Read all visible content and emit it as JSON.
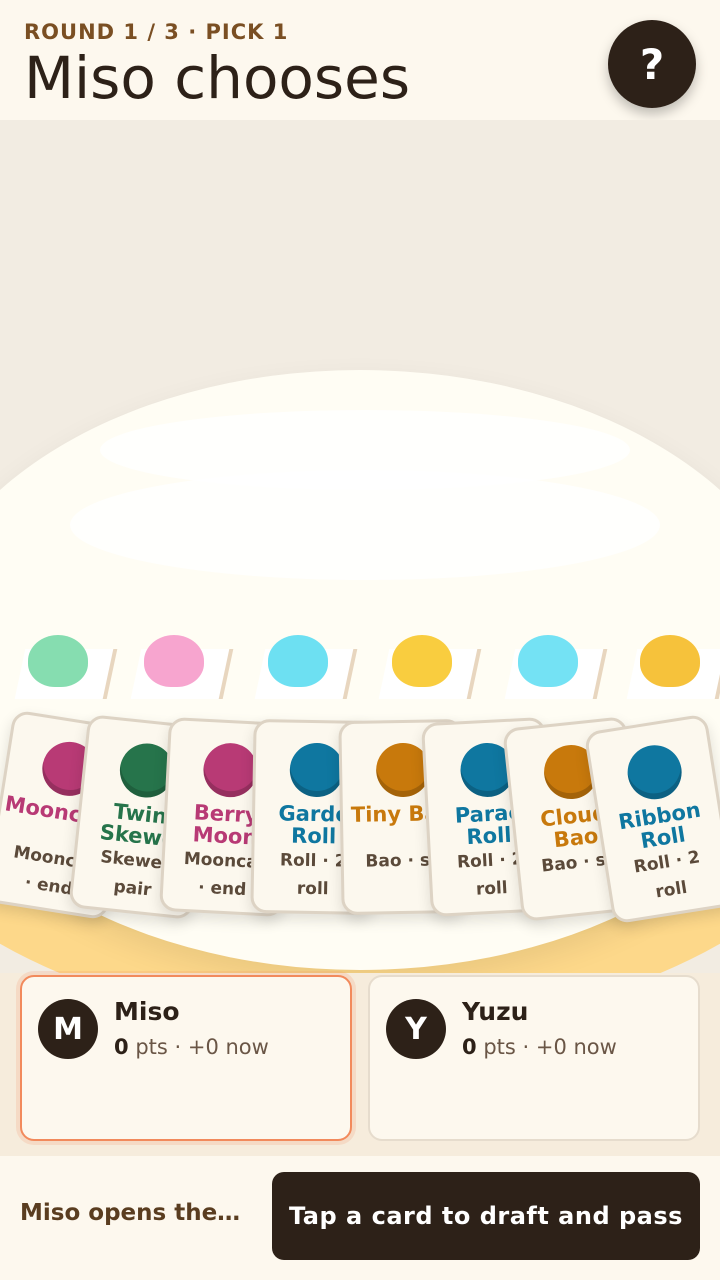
{
  "header": {
    "round_label": "ROUND 1 / 3 · PICK 1",
    "title": "Miso chooses",
    "help_label": "?"
  },
  "table": {
    "dumplings": [
      {
        "color": "#86ddb0"
      },
      {
        "color": "#f7a5cf"
      },
      {
        "color": "#6de0f2"
      },
      {
        "color": "#f9cd3f"
      },
      {
        "color": "#74e2f4"
      },
      {
        "color": "#f6c23b"
      }
    ],
    "hand": [
      {
        "name": "Moonc ke",
        "type": "Mooncal",
        "desc": "· end",
        "color": "#b83a75",
        "name_color": "#b83a75"
      },
      {
        "name": "Twin Skewe",
        "type": "Skewer",
        "desc": "pair",
        "color": "#26744b",
        "name_color": "#26744b"
      },
      {
        "name": "Berry Moon",
        "type": "Mooncal",
        "desc": "· end",
        "color": "#b83a75",
        "name_color": "#b83a75"
      },
      {
        "name": "Garde Roll",
        "type": "Roll · 2",
        "desc": "roll",
        "color": "#0f77a0",
        "name_color": "#0f77a0"
      },
      {
        "name": "Tiny Bao",
        "type": "Bao · sc",
        "desc": "",
        "color": "#c8790c",
        "name_color": "#c8790c"
      },
      {
        "name": "Parac Roll",
        "type": "Roll · 2",
        "desc": "roll",
        "color": "#0f77a0",
        "name_color": "#0f77a0"
      },
      {
        "name": "Cloud Bao",
        "type": "Bao · sc",
        "desc": "",
        "color": "#c8790c",
        "name_color": "#c8790c"
      },
      {
        "name": "Ribbon Roll",
        "type": "Roll · 2",
        "desc": "roll",
        "color": "#0f77a0",
        "name_color": "#0f77a0"
      }
    ]
  },
  "players": [
    {
      "initial": "M",
      "name": "Miso",
      "points": "0",
      "score_suffix": "pts · +0 now",
      "active": true
    },
    {
      "initial": "Y",
      "name": "Yuzu",
      "points": "0",
      "score_suffix": "pts · +0 now",
      "active": false
    }
  ],
  "footer": {
    "status": "Miso opens the…",
    "action_label": "Tap a card to draft and pass"
  },
  "colors": {
    "accent": "#f28a5c",
    "dark": "#2d2118"
  }
}
